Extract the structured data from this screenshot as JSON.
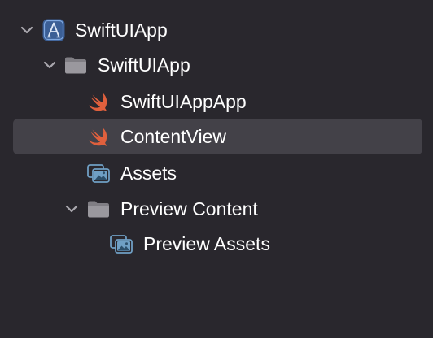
{
  "navigator": {
    "items": [
      {
        "label": "SwiftUIApp",
        "kind": "project",
        "expanded": true,
        "selected": false
      },
      {
        "label": "SwiftUIApp",
        "kind": "folder",
        "expanded": true,
        "selected": false
      },
      {
        "label": "SwiftUIAppApp",
        "kind": "swift-file",
        "selected": false
      },
      {
        "label": "ContentView",
        "kind": "swift-file",
        "selected": true
      },
      {
        "label": "Assets",
        "kind": "asset-catalog",
        "selected": false
      },
      {
        "label": "Preview Content",
        "kind": "folder",
        "expanded": true,
        "selected": false
      },
      {
        "label": "Preview Assets",
        "kind": "asset-catalog",
        "selected": false
      }
    ]
  },
  "colors": {
    "background": "#29272d",
    "selection": "#434148",
    "text": "#ffffff",
    "chevron": "#a9a7ad",
    "folder": "#9a989e",
    "swift": "#e0603d",
    "project": "#5b8fd8",
    "assets": "#6f9fc4"
  }
}
